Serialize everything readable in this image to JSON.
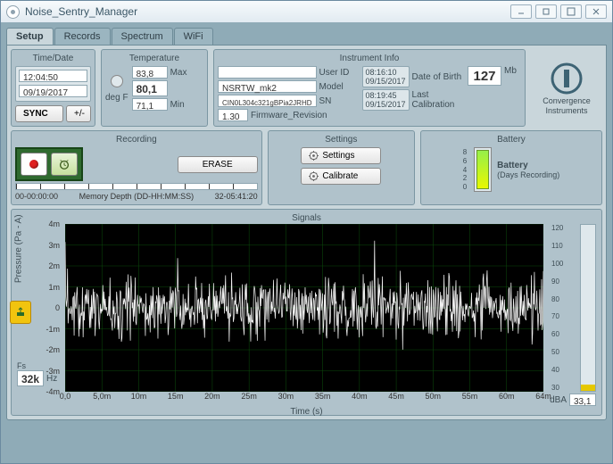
{
  "window": {
    "title": "Noise_Sentry_Manager"
  },
  "tabs": [
    {
      "label": "Setup",
      "active": true
    },
    {
      "label": "Records",
      "active": false
    },
    {
      "label": "Spectrum",
      "active": false
    },
    {
      "label": "WiFi",
      "active": false
    }
  ],
  "timedate": {
    "title": "Time/Date",
    "time": "12:04:50",
    "date": "09/19/2017",
    "sync_label": "SYNC",
    "adj_label": "+/-"
  },
  "temperature": {
    "title": "Temperature",
    "max_label": "Max",
    "max_val": "83,8",
    "cur_val": "80,1",
    "min_label": "Min",
    "min_val": "71,1",
    "unit": "deg F"
  },
  "instrument": {
    "title": "Instrument Info",
    "userid_val": "",
    "userid_lbl": "User ID",
    "model_val": "NSRTW_mk2",
    "model_lbl": "Model",
    "sn_val": "CIN0L304c321gBPia2JRHD",
    "sn_lbl": "SN",
    "fw_val": "1.30",
    "fw_lbl": "Firmware_Revision",
    "dob_t": "08:16:10",
    "dob_d": "09/15/2017",
    "dob_lbl": "Date of Birth",
    "cal_t": "08:19:45",
    "cal_d": "09/15/2017",
    "cal_lbl": "Last Calibration",
    "mem_val": "127",
    "mem_unit": "Mb"
  },
  "brand": {
    "line1": "Convergence",
    "line2": "Instruments"
  },
  "recording": {
    "title": "Recording",
    "erase_label": "ERASE",
    "mem_lbl": "Memory Depth (DD-HH:MM:SS)",
    "mem_left": "00-00:00:00",
    "mem_right": "32-05:41:20"
  },
  "settings": {
    "title": "Settings",
    "btn1": "Settings",
    "btn2": "Calibrate"
  },
  "battery": {
    "title": "Battery",
    "label": "Battery",
    "sub": "(Days Recording)",
    "scale": [
      "8",
      "6",
      "4",
      "2",
      "0"
    ]
  },
  "signals": {
    "title": "Signals",
    "ylabel": "Pressure (Pa - A)",
    "xlabel": "Time (s)",
    "yticks": [
      "4m",
      "3m",
      "2m",
      "1m",
      "0",
      "-1m",
      "-2m",
      "-3m",
      "-4m"
    ],
    "xticks": [
      "0,0",
      "5,0m",
      "10m",
      "15m",
      "20m",
      "25m",
      "30m",
      "35m",
      "40m",
      "45m",
      "50m",
      "55m",
      "60m",
      "64m"
    ],
    "fs_lbl": "Fs",
    "fs_val": "32k",
    "fs_unit": "Hz",
    "db_ticks": [
      "120",
      "110",
      "100",
      "90",
      "80",
      "70",
      "60",
      "50",
      "40",
      "30"
    ],
    "dba_lbl": "dBA",
    "dba_val": "33,1"
  },
  "chart_data": {
    "type": "line",
    "title": "",
    "xlabel": "Time (s)",
    "ylabel": "Pressure (Pa - A)",
    "xlim": [
      0,
      0.064
    ],
    "ylim": [
      -0.004,
      0.004
    ],
    "x_unit": "s",
    "y_unit": "Pa",
    "note": "Dense quasi-random acoustic pressure waveform; individual sample values not labeled. Amplitude spans roughly ±0.003 Pa with occasional peaks near ±0.0035 Pa across the 64 ms window.",
    "series": [
      {
        "name": "Pressure",
        "approx_peak": 0.0035,
        "approx_rms": 0.0012
      }
    ]
  }
}
